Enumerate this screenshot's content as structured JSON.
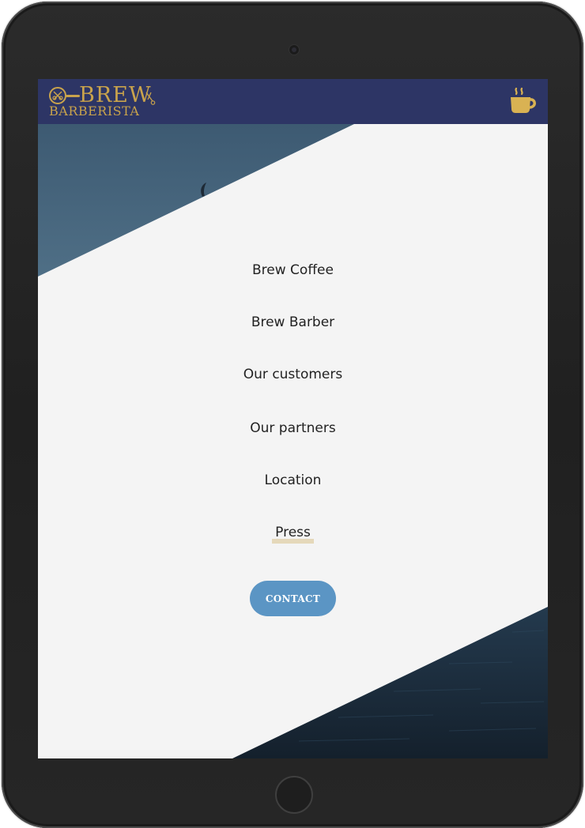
{
  "brand": {
    "name_top": "BREW",
    "name_bottom": "BARBERISTA",
    "color": "#c9a34c"
  },
  "header": {
    "background": "#2d3565",
    "menu_icon": "coffee-cup-icon"
  },
  "menu": {
    "items": [
      {
        "label": "Brew Coffee"
      },
      {
        "label": "Brew Barber"
      },
      {
        "label": "Our customers"
      },
      {
        "label": "Our partners"
      },
      {
        "label": "Location"
      },
      {
        "label": "Press",
        "active": true
      }
    ],
    "contact_label": "CONTACT",
    "contact_color": "#5b95c4"
  },
  "device": {
    "type": "tablet",
    "icons": [
      "camera-icon",
      "home-button-icon"
    ]
  }
}
